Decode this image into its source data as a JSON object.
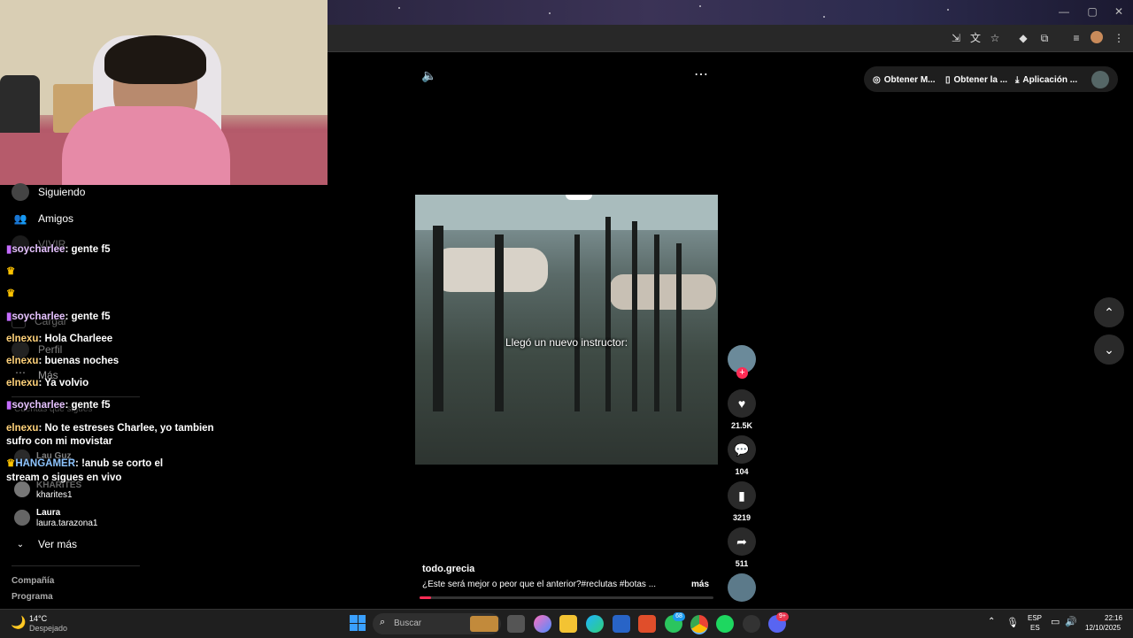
{
  "browser": {
    "window_controls": {
      "minimize": "—",
      "maximize": "▢",
      "close": "✕"
    }
  },
  "top_actions": {
    "get_m": "Obtener M...",
    "get_la": "Obtener la ...",
    "app": "Aplicación ..."
  },
  "sidebar": {
    "items": [
      {
        "label": "Siguiendo"
      },
      {
        "label": "Amigos"
      },
      {
        "label": "VIVIR"
      },
      {
        "label": "Cargar"
      },
      {
        "label": "Perfil"
      },
      {
        "label": "Más"
      }
    ],
    "section_title": "Cuentas que sigues",
    "accounts": [
      {
        "name": "Lau Guz",
        "handle": ""
      },
      {
        "name": "KHARITES",
        "handle": "kharites1"
      },
      {
        "name": "Laura",
        "handle": "laura.tarazona1"
      }
    ],
    "see_more": "Ver más",
    "footer": [
      "Compañía",
      "Programa"
    ]
  },
  "chat": [
    {
      "user": "soycharlee",
      "text": " gente f5"
    },
    {
      "user": "",
      "text": ""
    },
    {
      "user": "",
      "text": ""
    },
    {
      "user": "soycharlee",
      "text": " gente f5"
    },
    {
      "user": "elnexu",
      "text": " Hola Charleee"
    },
    {
      "user": "elnexu",
      "text": " buenas noches"
    },
    {
      "user": "elnexu",
      "text": " Ya volvio"
    },
    {
      "user": "soycharlee",
      "text": " gente f5"
    },
    {
      "user": "elnexu",
      "text": " No te estreses Charlee, yo tambien"
    },
    {
      "user": "",
      "text": "sufro con mi movistar"
    },
    {
      "user": "HANGAMER",
      "text": " !anub se corto el"
    },
    {
      "user": "",
      "text": "stream o sigues en vivo"
    }
  ],
  "video": {
    "caption": "Llegó un nuevo instructor:",
    "author": "todo.grecia",
    "description": "¿Este será mejor o peor que el anterior?#reclutas  #botas  ...",
    "more": "más"
  },
  "actions": {
    "likes": "21.5K",
    "comments": "104",
    "saves": "3219",
    "shares": "511"
  },
  "taskbar": {
    "weather_temp": "14°C",
    "weather_desc": "Despejado",
    "search_placeholder": "Buscar",
    "lang1": "ESP",
    "lang2": "ES",
    "time": "22:16",
    "date": "12/10/2025",
    "badge_whatsapp": "68",
    "badge_discord": "9+"
  },
  "colors": {
    "accent_red": "#fe2c55",
    "taskbar": "#1f1f1f"
  }
}
